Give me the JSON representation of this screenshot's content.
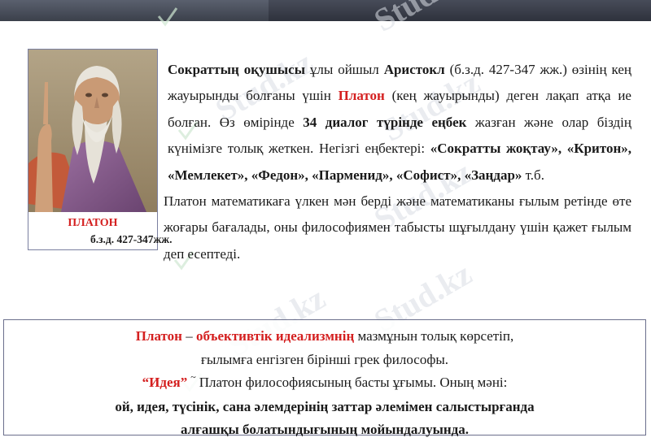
{
  "watermark": {
    "text": "Stud.kz"
  },
  "portrait": {
    "name": "ПЛАТОН",
    "dates": "б.з.д. 427-347жж."
  },
  "main": {
    "p1": {
      "s1": "Сократтың оқушысы",
      "s2": " ұлы ойшыл ",
      "s3": "Аристокл",
      "s4": " (б.з.д. 427-347 жж.) өзінің кең жауырынды болғаны үшін ",
      "s5": "Платон",
      "s6": " (кең жауырынды) деген лақап атқа ие болған. Өз өмірінде ",
      "s7": "34 диалог түрінде еңбек",
      "s8": " жазған және олар біздің күнімізге толық жеткен. Негізгі еңбектері: ",
      "s9": "«Сократты жоқтау», «Критон», «Мемлекет», «Федон», «Парменид», «Софист», «Заңдар»",
      "s10": " т.б."
    },
    "p2": "Платон математикаға үлкен мән берді  және математиканы ғылым ретінде өте жоғары бағалады, оны философиямен табысты шұғылдану үшін қажет ғылым деп есептеді."
  },
  "definition": {
    "l1_a": "Платон",
    "l1_b": " – ",
    "l1_c": "объективтік идеализмнің",
    "l1_d": " мазмұнын толық көрсетіп,",
    "l2": "ғылымға  енгізген бірінші грек философы.",
    "l3_a": "“Идея”",
    "l3_tilde": "~",
    "l3_b": "Платон философиясының басты ұғымы. Оның мәні:",
    "l4": "ой, идея, түсінік, сана әлемдерінің заттар әлемімен салыстырғанда",
    "l5": "алғашқы болатындығының мойындалуында."
  }
}
